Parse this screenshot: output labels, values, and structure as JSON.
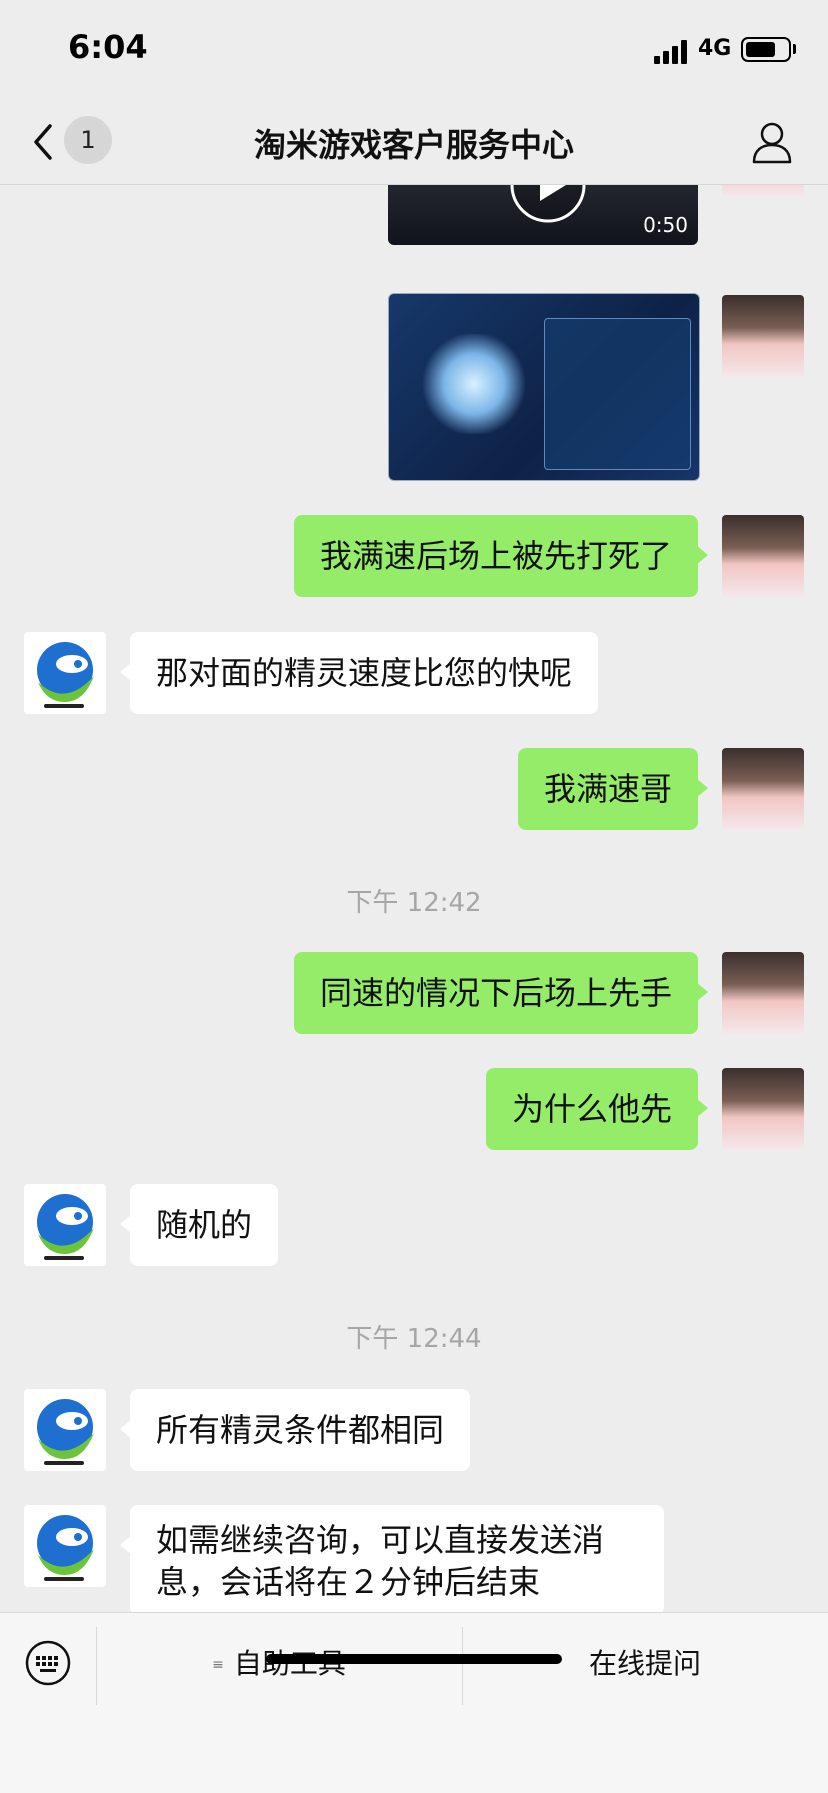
{
  "status_bar": {
    "time": "6:04",
    "network": "4G"
  },
  "nav": {
    "unread_count": "1",
    "title": "淘米游戏客户服务中心"
  },
  "chat": {
    "video": {
      "duration": "0:50"
    },
    "messages": [
      {
        "side": "out",
        "text": "我满速后场上被先打死了"
      },
      {
        "side": "in",
        "text": "那对面的精灵速度比您的快呢"
      },
      {
        "side": "out",
        "text": "我满速哥"
      },
      {
        "time": "下午 12:42"
      },
      {
        "side": "out",
        "text": "同速的情况下后场上先手"
      },
      {
        "side": "out",
        "text": "为什么他先"
      },
      {
        "side": "in",
        "text": "随机的"
      },
      {
        "time": "下午 12:44"
      },
      {
        "side": "in",
        "text": "所有精灵条件都相同"
      },
      {
        "side": "in",
        "text": "如需继续咨询，可以直接发送消息，会话将在２分钟后结束"
      }
    ]
  },
  "bottom_bar": {
    "self_help_label": "自助工具",
    "ask_online_label": "在线提问"
  },
  "icons": {
    "back": "chevron-left-icon",
    "profile": "person-icon",
    "keyboard": "keyboard-icon",
    "menu": "menu-icon",
    "play": "play-icon"
  },
  "colors": {
    "bubble_out": "#95ec69",
    "bubble_in": "#ffffff",
    "background": "#ededed"
  }
}
